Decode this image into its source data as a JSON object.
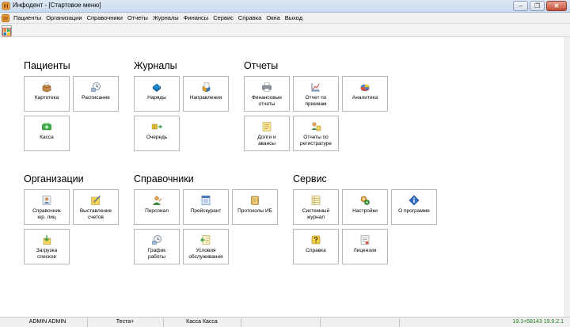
{
  "window": {
    "title": "Инфодент - [Стартовое меню]",
    "minimize_glyph": "–",
    "restore_glyph": "❐",
    "close_glyph": "✕"
  },
  "menubar": {
    "items": [
      "Пациенты",
      "Организации",
      "Справочники",
      "Отчеты",
      "Журналы",
      "Финансы",
      "Сервис",
      "Справка",
      "Окна",
      "Выход"
    ]
  },
  "sections": {
    "patients": {
      "title": "Пациенты",
      "tiles": [
        {
          "label": "Картотека",
          "icon": "card-index-icon"
        },
        {
          "label": "Расписание",
          "icon": "schedule-clock-icon"
        },
        {
          "label": "Касса",
          "icon": "cash-register-icon"
        }
      ]
    },
    "journals": {
      "title": "Журналы",
      "tiles": [
        {
          "label": "Наряды",
          "icon": "work-order-book-icon"
        },
        {
          "label": "Направления",
          "icon": "referrals-icon"
        },
        {
          "label": "Очередь",
          "icon": "queue-icon"
        }
      ]
    },
    "reports": {
      "title": "Отчеты",
      "tiles": [
        {
          "label": "Финансовые\nотчеты",
          "icon": "printer-icon"
        },
        {
          "label": "Отчет по\nприемам",
          "icon": "appointments-report-icon"
        },
        {
          "label": "Аналитика",
          "icon": "pie-chart-icon"
        },
        {
          "label": "Долги и\nавансы",
          "icon": "debts-icon"
        },
        {
          "label": "Отчеты по\nрегистратуре",
          "icon": "registry-report-icon"
        }
      ]
    },
    "organizations": {
      "title": "Организации",
      "tiles": [
        {
          "label": "Справочник\nюр. лиц",
          "icon": "legal-entities-icon"
        },
        {
          "label": "Выставление\nсчетов",
          "icon": "invoice-icon"
        },
        {
          "label": "Загрузка\nсписков",
          "icon": "upload-lists-icon"
        }
      ]
    },
    "references": {
      "title": "Справочники",
      "tiles": [
        {
          "label": "Персонал",
          "icon": "staff-icon"
        },
        {
          "label": "Прейскурант",
          "icon": "price-list-icon"
        },
        {
          "label": "Протоколы ИБ",
          "icon": "protocols-icon"
        },
        {
          "label": "График\nработы",
          "icon": "work-schedule-icon"
        },
        {
          "label": "Условия\nобслуживания",
          "icon": "service-terms-icon"
        }
      ]
    },
    "service": {
      "title": "Сервис",
      "tiles": [
        {
          "label": "Системный\nжурнал",
          "icon": "system-log-icon"
        },
        {
          "label": "Настройки",
          "icon": "settings-gear-icon"
        },
        {
          "label": "О программе",
          "icon": "info-icon"
        },
        {
          "label": "Справка",
          "icon": "help-icon"
        },
        {
          "label": "Лицензии",
          "icon": "license-icon"
        }
      ]
    }
  },
  "statusbar": {
    "user": "ADMIN ADMIN",
    "database": "Теста+",
    "cashbox": "Касса Касса",
    "version": "19.1<58143 19.9.2.1"
  }
}
